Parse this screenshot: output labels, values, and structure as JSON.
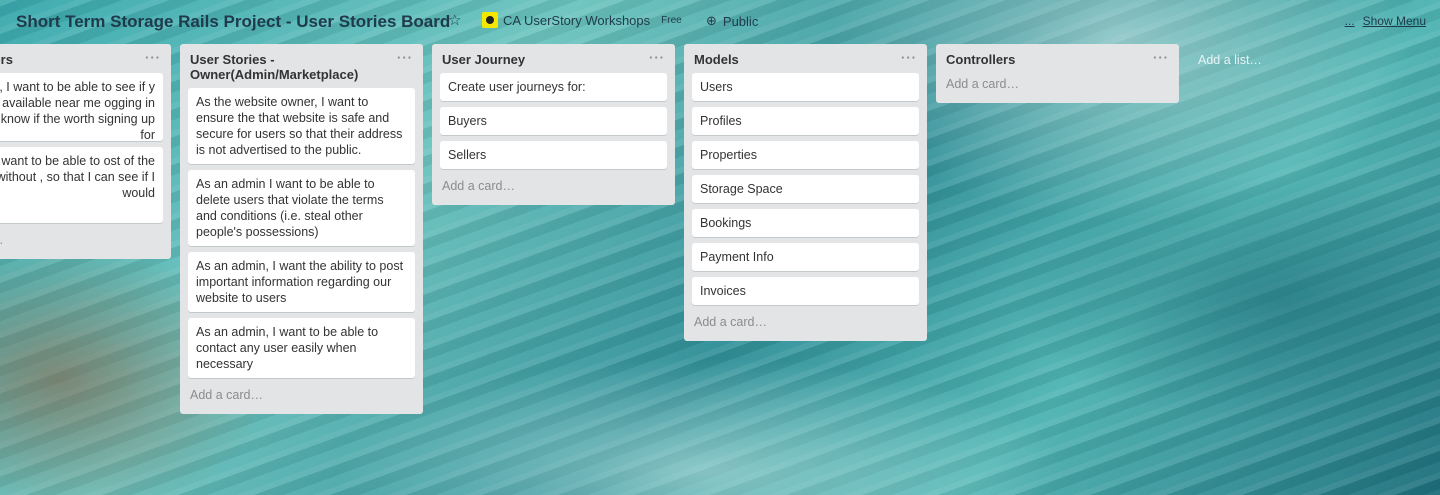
{
  "header": {
    "title": "Short Term Storage Rails Project - User Stories Board",
    "team": "CA UserStory Workshops",
    "plan_badge": "Free",
    "visibility": "Public",
    "show_menu": "Show Menu",
    "menu_dots": "...",
    "icons": {
      "star": "star-icon",
      "globe": "globe-icon"
    }
  },
  "lists": [
    {
      "title": "es - Viewers",
      "cards": [
        "er, I want to be able to see if y storage available near me ogging in so that I know if the worth signing up for",
        "er, I want to be able to ost of the website without , so that I can see if I would"
      ],
      "add_card": "..."
    },
    {
      "title": "User Stories - Owner(Admin/Marketplace)",
      "cards": [
        "As the website owner, I want to ensure the that website is safe and secure for users so that their address is not advertised to the public.",
        "As an admin I want to be able to delete users that violate the terms and conditions (i.e. steal other people's possessions)",
        "As an admin, I want the ability to post important information regarding our website to users",
        "As an admin, I want to be able to contact any user easily when necessary"
      ],
      "add_card": "Add a card…"
    },
    {
      "title": "User Journey",
      "cards": [
        "Create user journeys for:",
        "Buyers",
        "Sellers"
      ],
      "add_card": "Add a card…"
    },
    {
      "title": "Models",
      "cards": [
        "Users",
        "Profiles",
        "Properties",
        "Storage Space",
        "Bookings",
        "Payment Info",
        "Invoices"
      ],
      "add_card": "Add a card…"
    },
    {
      "title": "Controllers",
      "cards": [],
      "add_card": "Add a card…"
    }
  ],
  "list_menu": "···",
  "add_list": "Add a list…"
}
